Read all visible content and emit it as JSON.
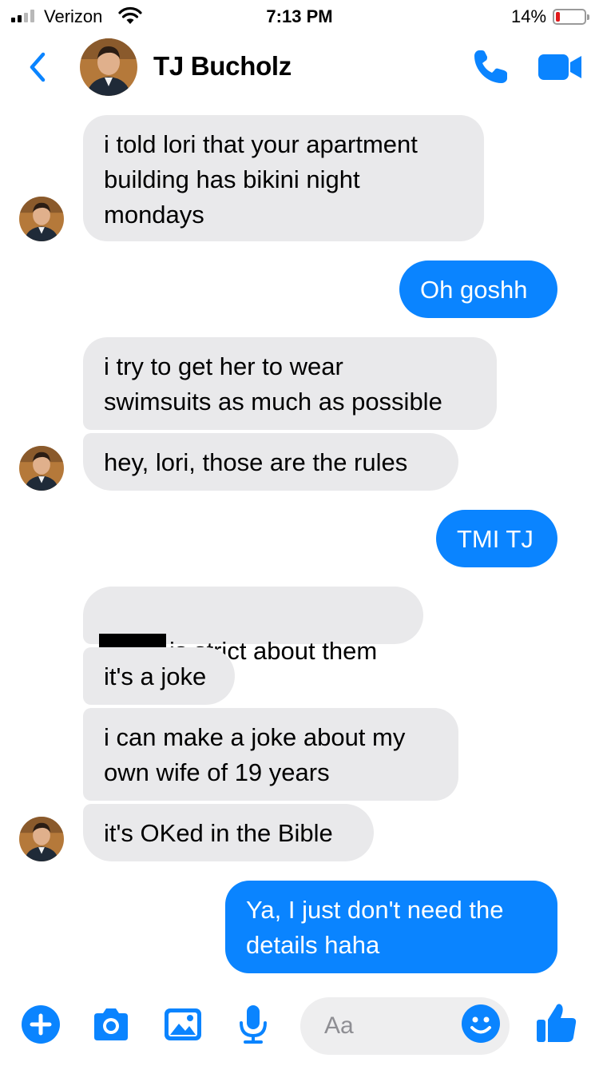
{
  "status_bar": {
    "carrier": "Verizon",
    "time": "7:13 PM",
    "battery_percent": "14%",
    "battery_level": 0.14,
    "battery_color": "#e0191b",
    "signal_bars": 2
  },
  "header": {
    "contact_name": "TJ Bucholz",
    "back_icon": "chevron-left-icon",
    "call_icon": "phone-icon",
    "video_icon": "video-camera-icon"
  },
  "colors": {
    "accent": "#0a84ff",
    "incoming_bubble": "#e9e9eb",
    "outgoing_bubble": "#0a84ff"
  },
  "messages": [
    {
      "sender": "TJ Bucholz",
      "direction": "incoming",
      "text": "i told lori that your apartment\nbuilding has bikini night\nmondays"
    },
    {
      "sender": "me",
      "direction": "outgoing",
      "text": "Oh goshh"
    },
    {
      "sender": "TJ Bucholz",
      "direction": "incoming",
      "text": "i try to get her to wear\nswimsuits as much as possible"
    },
    {
      "sender": "TJ Bucholz",
      "direction": "incoming",
      "text": "hey, lori, those are the rules"
    },
    {
      "sender": "me",
      "direction": "outgoing",
      "text": "TMI TJ"
    },
    {
      "sender": "TJ Bucholz",
      "direction": "incoming",
      "text": "is strict about them",
      "redacted_prefix": true
    },
    {
      "sender": "TJ Bucholz",
      "direction": "incoming",
      "text": "it's a joke"
    },
    {
      "sender": "TJ Bucholz",
      "direction": "incoming",
      "text": "i can make a joke about my\nown wife of 19 years"
    },
    {
      "sender": "TJ Bucholz",
      "direction": "incoming",
      "text": "it's OKed in the Bible"
    },
    {
      "sender": "me",
      "direction": "outgoing",
      "text": "Ya, I just don't need the\ndetails haha"
    }
  ],
  "composer": {
    "placeholder": "Aa",
    "tools": [
      "plus-icon",
      "camera-icon",
      "image-icon",
      "microphone-icon"
    ],
    "emoji_icon": "smiley-icon",
    "like_icon": "thumbs-up-icon"
  }
}
